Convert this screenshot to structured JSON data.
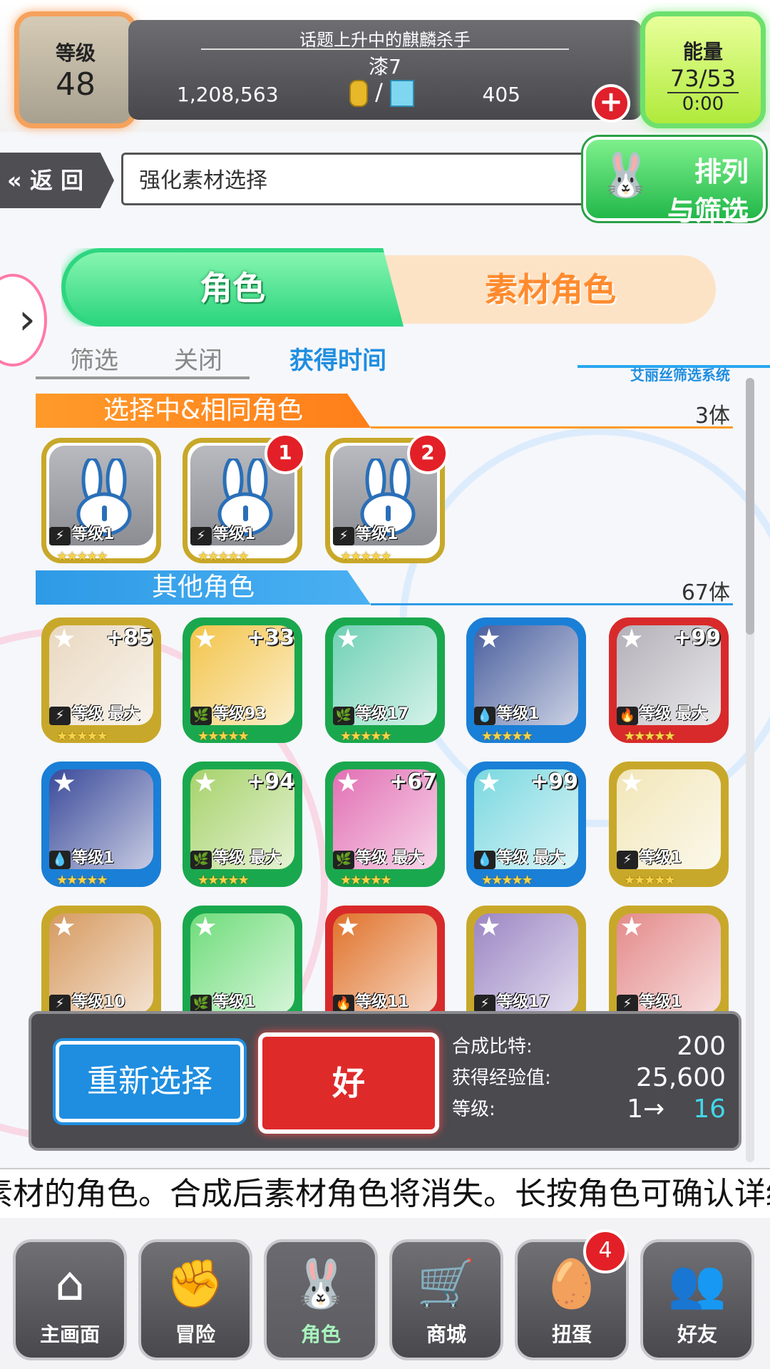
{
  "header": {
    "level_label": "等级",
    "level_value": "48",
    "title_line1": "话题上升中的麒麟杀手",
    "player_name": "漆7",
    "gold": "1,208,563",
    "currency_sep": "/",
    "gems": "405",
    "energy_label": "能量",
    "energy_value": "73/53",
    "energy_timer": "0:00"
  },
  "subheader": {
    "back_label": "返 回",
    "title": "强化素材选择",
    "sort_label_1": "排列",
    "sort_label_2": "与筛选"
  },
  "tabs": [
    {
      "label": "角色",
      "active": true
    },
    {
      "label": "素材角色",
      "active": false
    }
  ],
  "filter": {
    "filter_label": "筛选",
    "state": "关闭",
    "sort_by": "获得时间",
    "system_label": "艾丽丝筛选系统"
  },
  "selected_section": {
    "title": "选择中&相同角色",
    "count": "3体",
    "items": [
      {
        "level": "等级1",
        "stars": "★★★★★",
        "badge": ""
      },
      {
        "level": "等级1",
        "stars": "★★★★★",
        "badge": "1"
      },
      {
        "level": "等级1",
        "stars": "★★★★★",
        "badge": "2"
      }
    ]
  },
  "other_section": {
    "title": "其他角色",
    "count": "67体",
    "rows": [
      [
        {
          "plus": "+85",
          "level": "等级 最大",
          "stars": "★★★★★",
          "color": "#c8a82a",
          "fill": "#e9d8c0",
          "elem": "⚡"
        },
        {
          "plus": "+33",
          "level": "等级93",
          "stars": "★★★★★",
          "color": "#1aa84e",
          "fill": "#f3c44a",
          "elem": "🌿"
        },
        {
          "plus": "",
          "level": "等级17",
          "stars": "★★★★★",
          "color": "#1aa84e",
          "fill": "#6fd1b4",
          "elem": "🌿"
        },
        {
          "plus": "",
          "level": "等级1",
          "stars": "★★★★★",
          "color": "#1a7fd6",
          "fill": "#4a5f9e",
          "elem": "💧"
        },
        {
          "plus": "+99",
          "level": "等级 最大",
          "stars": "★★★★★",
          "color": "#d82a2a",
          "fill": "#b3b0b8",
          "elem": "🔥"
        }
      ],
      [
        {
          "plus": "",
          "level": "等级1",
          "stars": "★★★★★",
          "color": "#1a7fd6",
          "fill": "#3a4a9a",
          "elem": "💧"
        },
        {
          "plus": "+94",
          "level": "等级 最大",
          "stars": "★★★★★",
          "color": "#1aa84e",
          "fill": "#a6d26a",
          "elem": "🌿"
        },
        {
          "plus": "+67",
          "level": "等级 最大",
          "stars": "★★★★★",
          "color": "#1aa84e",
          "fill": "#e26fb4",
          "elem": "🌿"
        },
        {
          "plus": "+99",
          "level": "等级 最大",
          "stars": "★★★★★",
          "color": "#1a7fd6",
          "fill": "#7ad8e0",
          "elem": "💧"
        },
        {
          "plus": "",
          "level": "等级1",
          "stars": "★★★★★",
          "color": "#c8a82a",
          "fill": "#f2e6b8",
          "elem": "⚡"
        }
      ],
      [
        {
          "plus": "",
          "level": "等级10",
          "stars": "★★★★★",
          "color": "#c8a82a",
          "fill": "#d69a60",
          "elem": "⚡"
        },
        {
          "plus": "",
          "level": "等级1",
          "stars": "★★★★★",
          "color": "#1aa84e",
          "fill": "#6fdc7a",
          "elem": "🌿"
        },
        {
          "plus": "",
          "level": "等级11",
          "stars": "★★★★★",
          "color": "#d82a2a",
          "fill": "#e0722a",
          "elem": "🔥"
        },
        {
          "plus": "",
          "level": "等级17",
          "stars": "★★★★★",
          "color": "#c8a82a",
          "fill": "#9b86c4",
          "elem": "⚡"
        },
        {
          "plus": "",
          "level": "等级1",
          "stars": "★★★★★",
          "color": "#c8a82a",
          "fill": "#e48a8a",
          "elem": "⚡"
        }
      ]
    ]
  },
  "summary_panel": {
    "reselect_label": "重新选择",
    "ok_label": "好",
    "bits_label": "合成比特:",
    "bits_value": "200",
    "exp_label": "获得经验值:",
    "exp_value": "25,600",
    "level_label": "等级:",
    "level_from": "1→",
    "level_to": "16"
  },
  "marquee_text": "素材的角色。合成后素材角色将消失。长按角色可确认详细",
  "nav": [
    {
      "label": "主画面",
      "icon": "home-icon",
      "glyph": "⌂"
    },
    {
      "label": "冒险",
      "icon": "handshake-icon",
      "glyph": "✊"
    },
    {
      "label": "角色",
      "icon": "rabbit-icon",
      "glyph": "🐰"
    },
    {
      "label": "商城",
      "icon": "cart-icon",
      "glyph": "🛒"
    },
    {
      "label": "扭蛋",
      "icon": "egg-icon",
      "glyph": "🥚",
      "badge": "4"
    },
    {
      "label": "好友",
      "icon": "friends-icon",
      "glyph": "👥"
    }
  ]
}
